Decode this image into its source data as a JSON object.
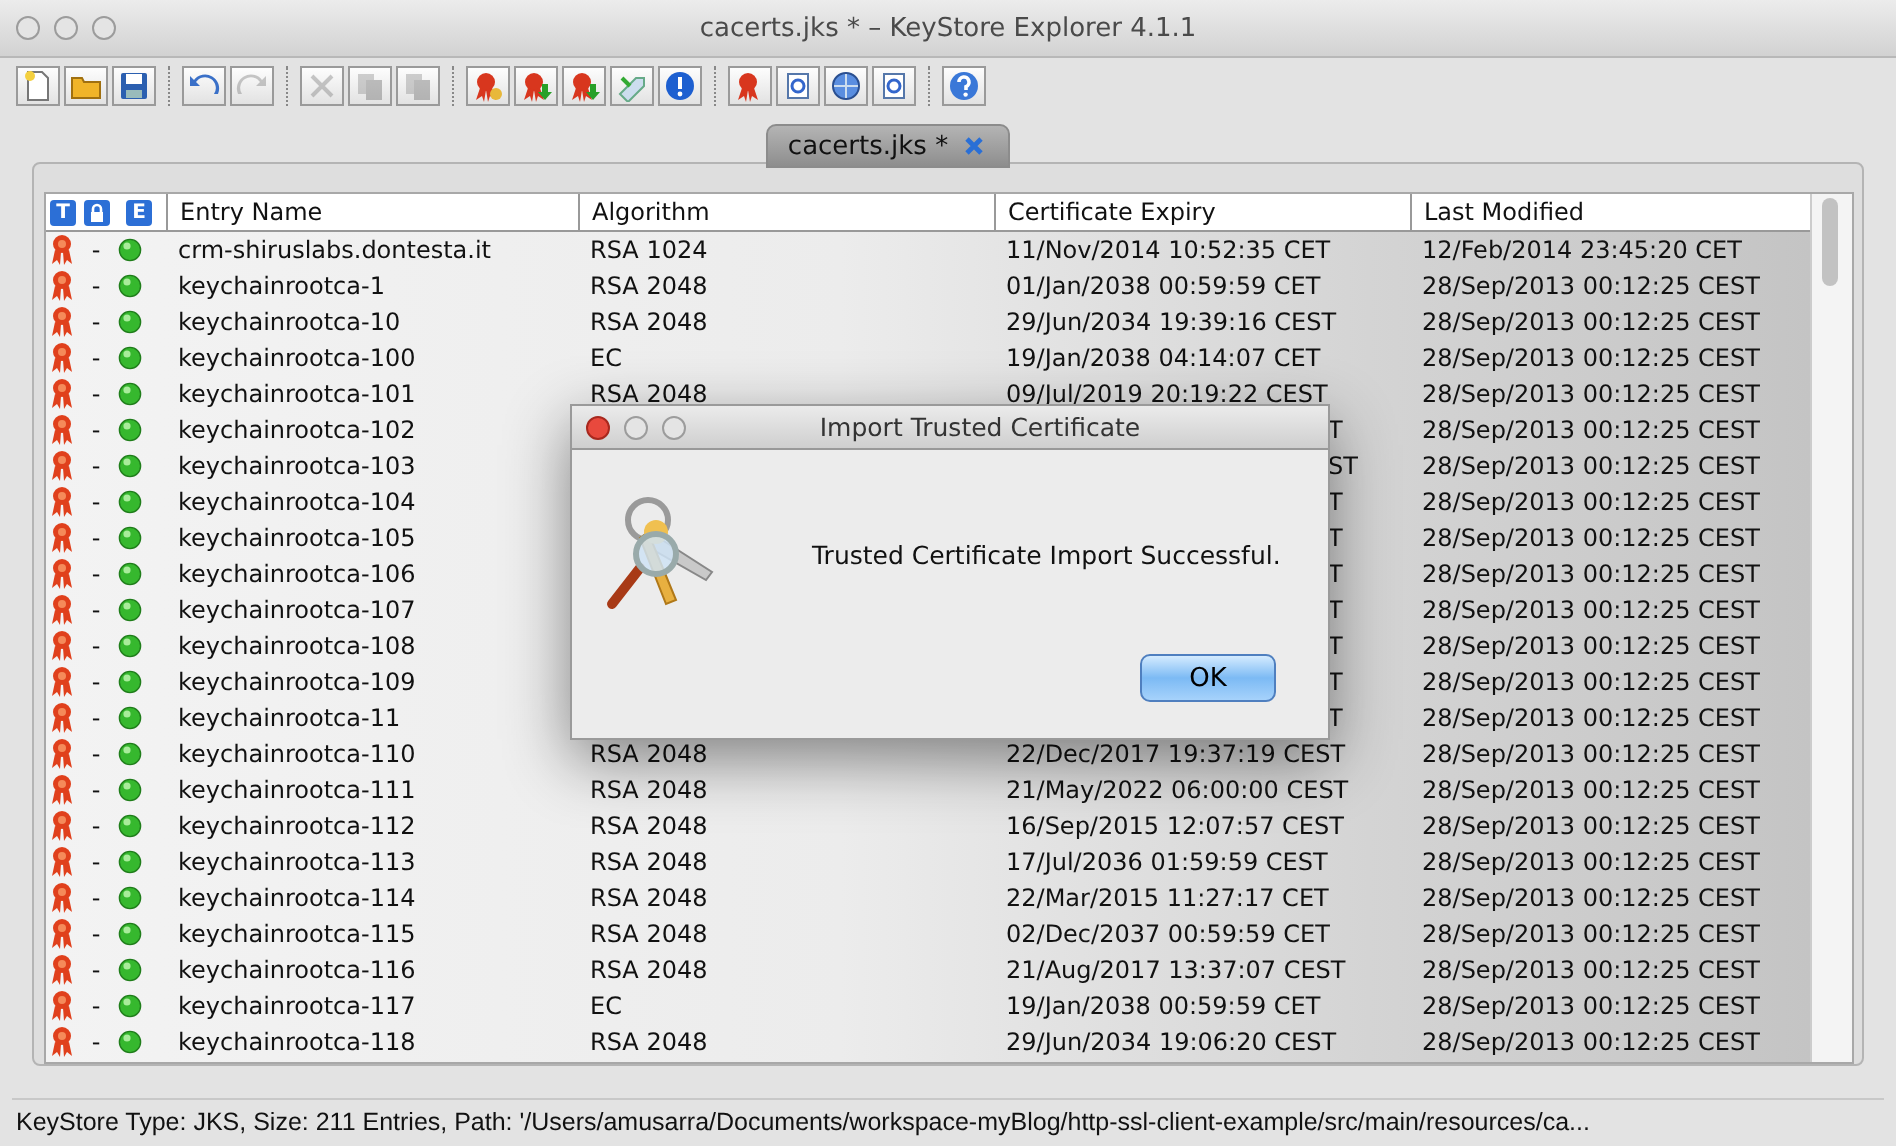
{
  "window": {
    "title": "cacerts.jks * – KeyStore Explorer 4.1.1"
  },
  "toolbar": [
    [
      {
        "kind": "new",
        "disabled": false
      },
      {
        "kind": "open",
        "disabled": false
      },
      {
        "kind": "save",
        "disabled": false
      }
    ],
    [
      {
        "kind": "undo",
        "disabled": false
      },
      {
        "kind": "redo",
        "disabled": true
      }
    ],
    [
      {
        "kind": "cut",
        "disabled": true
      },
      {
        "kind": "copy",
        "disabled": true
      },
      {
        "kind": "paste",
        "disabled": true
      }
    ],
    [
      {
        "kind": "keypair",
        "disabled": false
      },
      {
        "kind": "import-cert",
        "disabled": false
      },
      {
        "kind": "import-keypair",
        "disabled": false
      },
      {
        "kind": "password",
        "disabled": false
      },
      {
        "kind": "info",
        "disabled": false
      }
    ],
    [
      {
        "kind": "examine-cert",
        "disabled": false
      },
      {
        "kind": "examine-file",
        "disabled": false
      },
      {
        "kind": "examine-ssl",
        "disabled": false
      },
      {
        "kind": "examine-csr",
        "disabled": false
      }
    ],
    [
      {
        "kind": "help",
        "disabled": false
      }
    ]
  ],
  "tabs": [
    {
      "label": "cacerts.jks *",
      "selected": true
    }
  ],
  "table": {
    "columns": [
      {
        "kind": "letter",
        "label": "T"
      },
      {
        "kind": "lock"
      },
      {
        "kind": "letter",
        "label": "E"
      },
      {
        "kind": "text",
        "label": "Entry Name"
      },
      {
        "kind": "text",
        "label": "Algorithm"
      },
      {
        "kind": "text",
        "label": "Certificate Expiry"
      },
      {
        "kind": "text",
        "label": "Last Modified"
      }
    ],
    "rows": [
      {
        "lock": "-",
        "name": "crm-shiruslabs.dontesta.it",
        "algorithm": "RSA 1024",
        "expiry": "11/Nov/2014 10:52:35 CET",
        "modified": "12/Feb/2014 23:45:20 CET"
      },
      {
        "lock": "-",
        "name": "keychainrootca-1",
        "algorithm": "RSA 2048",
        "expiry": "01/Jan/2038 00:59:59 CET",
        "modified": "28/Sep/2013 00:12:25 CEST"
      },
      {
        "lock": "-",
        "name": "keychainrootca-10",
        "algorithm": "RSA 2048",
        "expiry": "29/Jun/2034 19:39:16 CEST",
        "modified": "28/Sep/2013 00:12:25 CEST"
      },
      {
        "lock": "-",
        "name": "keychainrootca-100",
        "algorithm": "EC",
        "expiry": "19/Jan/2038 04:14:07 CET",
        "modified": "28/Sep/2013 00:12:25 CEST"
      },
      {
        "lock": "-",
        "name": "keychainrootca-101",
        "algorithm": "RSA 2048",
        "expiry": "09/Jul/2019 20:19:22 CEST",
        "modified": "28/Sep/2013 00:12:25 CEST"
      },
      {
        "lock": "-",
        "name": "keychainrootca-102",
        "expiry": "T",
        "modified": "28/Sep/2013 00:12:25 CEST"
      },
      {
        "lock": "-",
        "name": "keychainrootca-103",
        "expiry": "ST",
        "modified": "28/Sep/2013 00:12:25 CEST"
      },
      {
        "lock": "-",
        "name": "keychainrootca-104",
        "expiry": "T",
        "modified": "28/Sep/2013 00:12:25 CEST"
      },
      {
        "lock": "-",
        "name": "keychainrootca-105",
        "expiry": "T",
        "modified": "28/Sep/2013 00:12:25 CEST"
      },
      {
        "lock": "-",
        "name": "keychainrootca-106",
        "expiry": "T",
        "modified": "28/Sep/2013 00:12:25 CEST"
      },
      {
        "lock": "-",
        "name": "keychainrootca-107",
        "expiry": "T",
        "modified": "28/Sep/2013 00:12:25 CEST"
      },
      {
        "lock": "-",
        "name": "keychainrootca-108",
        "expiry": "T",
        "modified": "28/Sep/2013 00:12:25 CEST"
      },
      {
        "lock": "-",
        "name": "keychainrootca-109",
        "expiry": "T",
        "modified": "28/Sep/2013 00:12:25 CEST"
      },
      {
        "lock": "-",
        "name": "keychainrootca-11",
        "expiry": "T",
        "modified": "28/Sep/2013 00:12:25 CEST"
      },
      {
        "lock": "-",
        "name": "keychainrootca-110",
        "algorithm": "RSA 2048",
        "expiry": "22/Dec/2017 19:37:19 CEST",
        "modified": "28/Sep/2013 00:12:25 CEST"
      },
      {
        "lock": "-",
        "name": "keychainrootca-111",
        "algorithm": "RSA 2048",
        "expiry": "21/May/2022 06:00:00 CEST",
        "modified": "28/Sep/2013 00:12:25 CEST"
      },
      {
        "lock": "-",
        "name": "keychainrootca-112",
        "algorithm": "RSA 2048",
        "expiry": "16/Sep/2015 12:07:57 CEST",
        "modified": "28/Sep/2013 00:12:25 CEST"
      },
      {
        "lock": "-",
        "name": "keychainrootca-113",
        "algorithm": "RSA 2048",
        "expiry": "17/Jul/2036 01:59:59 CEST",
        "modified": "28/Sep/2013 00:12:25 CEST"
      },
      {
        "lock": "-",
        "name": "keychainrootca-114",
        "algorithm": "RSA 2048",
        "expiry": "22/Mar/2015 11:27:17 CET",
        "modified": "28/Sep/2013 00:12:25 CEST"
      },
      {
        "lock": "-",
        "name": "keychainrootca-115",
        "algorithm": "RSA 2048",
        "expiry": "02/Dec/2037 00:59:59 CET",
        "modified": "28/Sep/2013 00:12:25 CEST"
      },
      {
        "lock": "-",
        "name": "keychainrootca-116",
        "algorithm": "RSA 2048",
        "expiry": "21/Aug/2017 13:37:07 CEST",
        "modified": "28/Sep/2013 00:12:25 CEST"
      },
      {
        "lock": "-",
        "name": "keychainrootca-117",
        "algorithm": "EC",
        "expiry": "19/Jan/2038 00:59:59 CET",
        "modified": "28/Sep/2013 00:12:25 CEST"
      },
      {
        "lock": "-",
        "name": "keychainrootca-118",
        "algorithm": "RSA 2048",
        "expiry": "29/Jun/2034 19:06:20 CEST",
        "modified": "28/Sep/2013 00:12:25 CEST"
      }
    ]
  },
  "dialog": {
    "title": "Import Trusted Certificate",
    "message": "Trusted Certificate Import Successful.",
    "button": "OK"
  },
  "status_bar": "KeyStore Type: JKS, Size: 211 Entries, Path: '/Users/amusarra/Documents/workspace-myBlog/http-ssl-client-example/src/main/resources/ca..."
}
